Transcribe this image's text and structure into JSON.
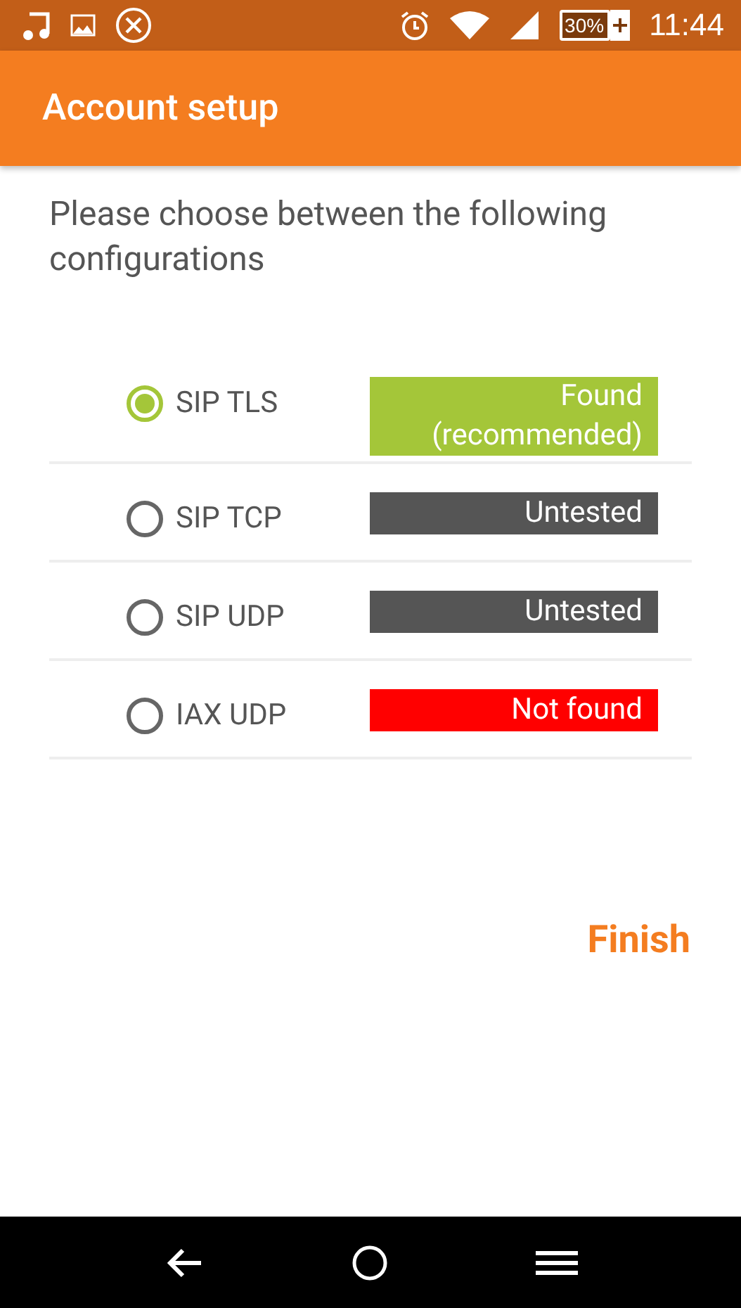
{
  "status_bar": {
    "time": "11:44",
    "battery": "30%"
  },
  "app_bar": {
    "title": "Account setup"
  },
  "prompt": "Please choose between the following configurations",
  "options": [
    {
      "label": "SIP TLS",
      "selected": true,
      "status": "Found\n(recommended)",
      "color": "#a4c639"
    },
    {
      "label": "SIP TCP",
      "selected": false,
      "status": "Untested",
      "color": "#555555"
    },
    {
      "label": "SIP UDP",
      "selected": false,
      "status": "Untested",
      "color": "#555555"
    },
    {
      "label": "IAX UDP",
      "selected": false,
      "status": "Not found",
      "color": "#ff0000"
    }
  ],
  "finish_button": "Finish"
}
